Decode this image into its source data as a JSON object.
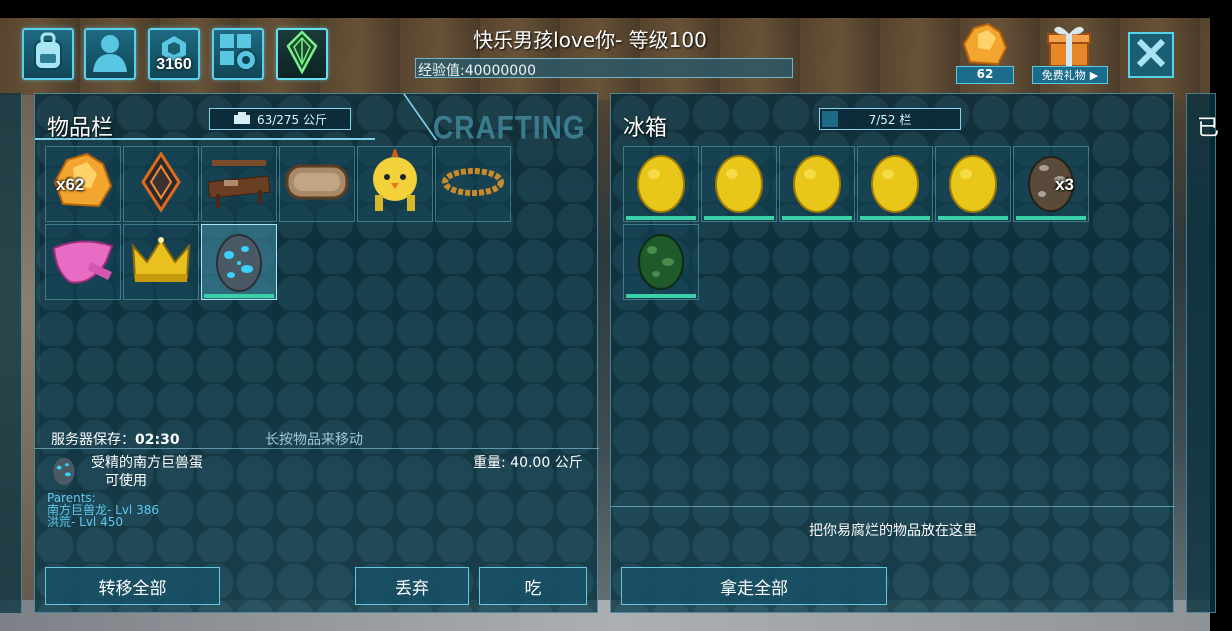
{
  "topbar": {
    "player_name": "快乐男孩love你- 等级100",
    "xp_text": "经验值:40000000",
    "xp_fraction": 0.99,
    "tribe_badge": "3160",
    "resource_count": "62",
    "gift_label": "免费礼物",
    "buttons": [
      "backpack-icon",
      "character-icon",
      "tribe-icon",
      "settings-icon",
      "crystal-icon"
    ]
  },
  "inventory": {
    "title": "物品栏",
    "weight": "63/275 公斤",
    "crafting_tab": "CRAFTING",
    "items": [
      {
        "name": "element-crystal-icon",
        "qty": "x62"
      },
      {
        "name": "tek-implant-icon",
        "qty": ""
      },
      {
        "name": "crafting-table-icon",
        "qty": ""
      },
      {
        "name": "wooden-sign-icon",
        "qty": ""
      },
      {
        "name": "chick-hat-icon",
        "qty": ""
      },
      {
        "name": "gold-chain-icon",
        "qty": ""
      },
      {
        "name": "pink-scarf-icon",
        "qty": ""
      },
      {
        "name": "gold-crown-icon",
        "qty": ""
      },
      {
        "name": "blue-spotted-egg-icon",
        "qty": ""
      }
    ],
    "server_save_label": "服务器保存：",
    "server_save_time": "02:30",
    "hint": "长按物品来移动",
    "selected_item": {
      "name": "受精的南方巨兽蛋",
      "status": "可使用",
      "weight": "重量: 40.00 公斤",
      "parents_label": "Parents:",
      "parent1": "南方巨兽龙- Lvl 386",
      "parent2": "洪荒- Lvl 450"
    },
    "buttons": {
      "transfer_all": "转移全部",
      "drop": "丢弃",
      "eat": "吃"
    }
  },
  "fridge": {
    "title": "冰箱",
    "capacity": "7/52 栏",
    "capacity_fraction": 0.13,
    "items": [
      {
        "name": "yellow-egg-icon",
        "qty": ""
      },
      {
        "name": "yellow-egg-icon",
        "qty": ""
      },
      {
        "name": "yellow-egg-icon",
        "qty": ""
      },
      {
        "name": "yellow-egg-icon",
        "qty": ""
      },
      {
        "name": "yellow-egg-icon",
        "qty": ""
      },
      {
        "name": "brown-spotted-egg-icon",
        "qty": "x3"
      },
      {
        "name": "green-spotted-egg-icon",
        "qty": ""
      }
    ],
    "hint": "把你易腐烂的物品放在这里",
    "take_all": "拿走全部"
  },
  "edge_panel_char": "已",
  "colors": {
    "accent": "#5bd0ea",
    "panel_bg": "#0a3442",
    "freshness_bar": "#3ad0a8"
  }
}
